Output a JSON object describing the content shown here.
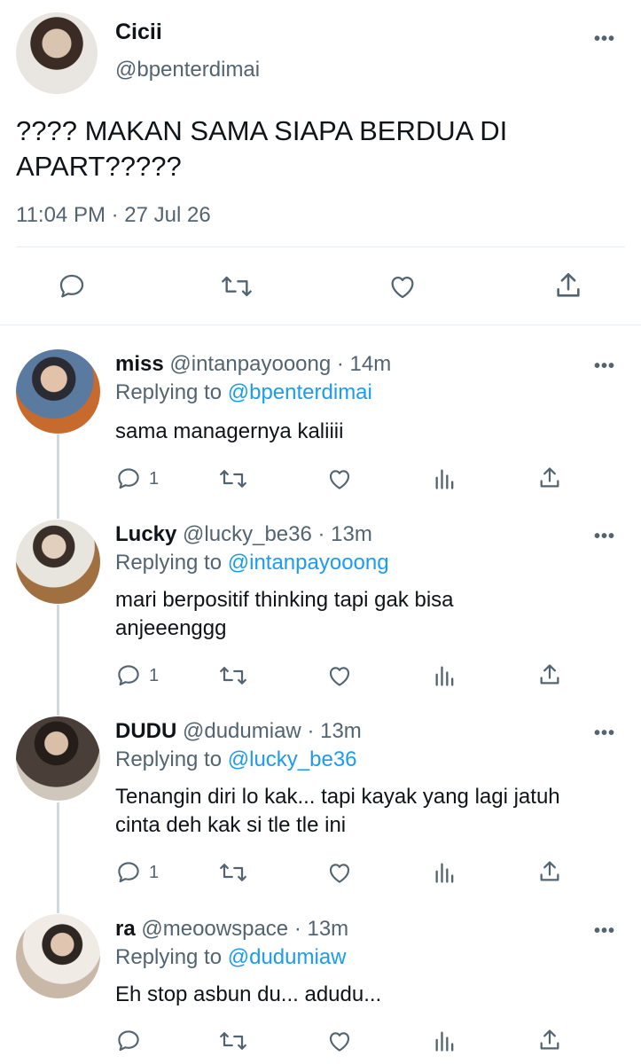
{
  "main_tweet": {
    "name": "Cicii",
    "handle": "@bpenterdimai",
    "text_line1": "???? MAKAN SAMA SIAPA BERDUA DI",
    "text_line2": "APART?????",
    "timestamp": "11:04 PM · 27 Jul 26"
  },
  "replies": [
    {
      "name": "miss",
      "handle": "@intanpayooong",
      "time": "· 14m",
      "replying_prefix": "Replying to",
      "replying_to": "@bpenterdimai",
      "text_line1": "sama managernya kaliiii",
      "text_line2": "",
      "reply_count": "1"
    },
    {
      "name": "Lucky",
      "handle": "@lucky_be36",
      "time": "· 13m",
      "replying_prefix": "Replying to",
      "replying_to": "@intanpayooong",
      "text_line1": "mari berpositif thinking tapi gak bisa",
      "text_line2": "anjeeenggg",
      "reply_count": "1"
    },
    {
      "name": "DUDU",
      "handle": "@dudumiaw",
      "time": "· 13m",
      "replying_prefix": "Replying to",
      "replying_to": "@lucky_be36",
      "text_line1": "Tenangin diri lo kak... tapi kayak yang lagi jatuh",
      "text_line2": "cinta deh kak si tle tle ini",
      "reply_count": "1"
    },
    {
      "name": "ra",
      "handle": "@meoowspace",
      "time": "· 13m",
      "replying_prefix": "Replying to",
      "replying_to": "@dudumiaw",
      "text_line1": "Eh stop asbun du... adudu...",
      "text_line2": "",
      "reply_count": ""
    }
  ],
  "icons": {
    "more": "more-dots-icon",
    "reply": "reply-bubble-icon",
    "retweet": "retweet-icon",
    "like": "heart-icon",
    "analytics": "analytics-bars-icon",
    "share": "share-upload-icon"
  },
  "colors": {
    "link_blue": "#1d9bf0",
    "muted_gray": "#536471",
    "text": "#0f1419"
  }
}
